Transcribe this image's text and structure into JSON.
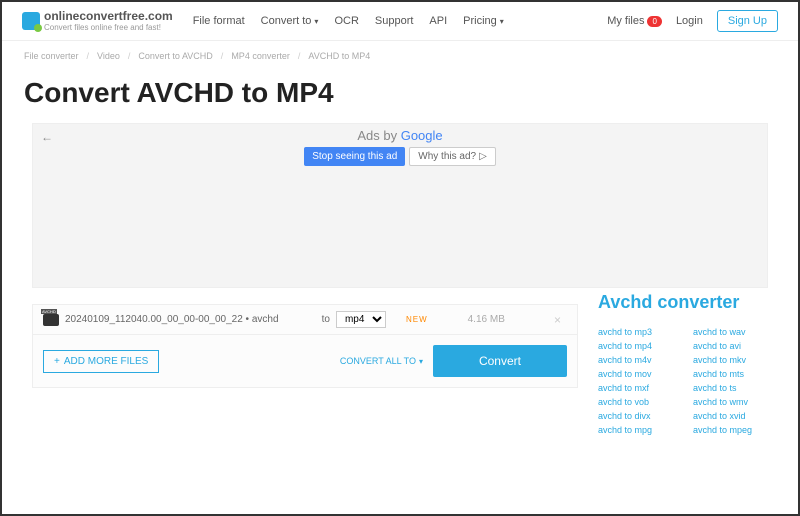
{
  "header": {
    "brand_name": "onlineconvertfree.com",
    "brand_sub": "Convert files online free and fast!",
    "nav": {
      "file_format": "File format",
      "convert_to": "Convert to",
      "ocr": "OCR",
      "support": "Support",
      "api": "API",
      "pricing": "Pricing"
    },
    "myfiles": "My files",
    "myfiles_count": "0",
    "login": "Login",
    "signup": "Sign Up"
  },
  "breadcrumb": {
    "b1": "File converter",
    "b2": "Video",
    "b3": "Convert to AVCHD",
    "b4": "MP4 converter",
    "b5": "AVCHD to MP4"
  },
  "page": {
    "title": "Convert AVCHD to MP4"
  },
  "ad": {
    "label_prefix": "Ads by ",
    "label_google": "Google",
    "stop": "Stop seeing this ad",
    "why": "Why this ad?"
  },
  "file": {
    "name": "20240109_112040.00_00_00-00_00_22 • avchd",
    "to": "to",
    "format": "mp4",
    "new": "NEW",
    "size": "4.16 MB"
  },
  "actions": {
    "add_more": "ADD MORE FILES",
    "convert_all": "CONVERT ALL TO",
    "convert": "Convert"
  },
  "sidebar": {
    "title": "Avchd converter",
    "links": {
      "l0": "avchd to mp3",
      "r0": "avchd to wav",
      "l1": "avchd to mp4",
      "r1": "avchd to avi",
      "l2": "avchd to m4v",
      "r2": "avchd to mkv",
      "l3": "avchd to mov",
      "r3": "avchd to mts",
      "l4": "avchd to mxf",
      "r4": "avchd to ts",
      "l5": "avchd to vob",
      "r5": "avchd to wmv",
      "l6": "avchd to divx",
      "r6": "avchd to xvid",
      "l7": "avchd to mpg",
      "r7": "avchd to mpeg"
    }
  }
}
